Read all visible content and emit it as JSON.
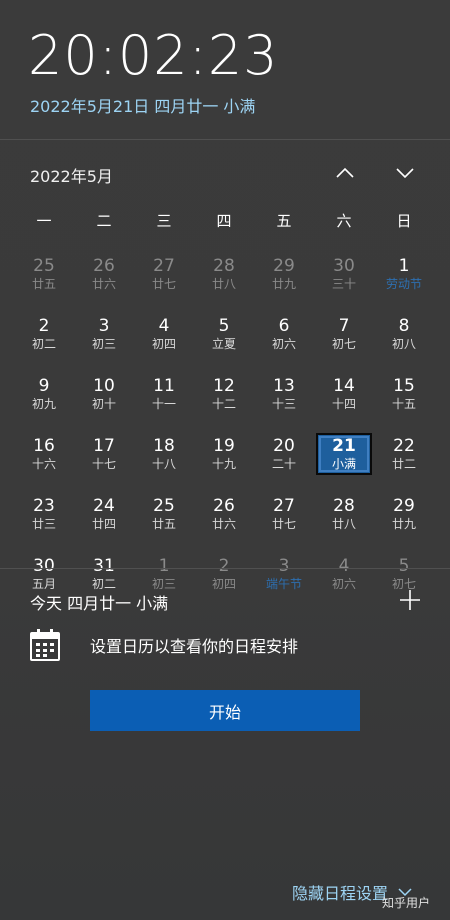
{
  "clock": {
    "time": "20:02:23",
    "date": "2022年5月21日 四月廿一 小满"
  },
  "calendar": {
    "month_title": "2022年5月",
    "weekdays": [
      "一",
      "二",
      "三",
      "四",
      "五",
      "六",
      "日"
    ],
    "days": [
      {
        "num": "25",
        "lunar": "廿五",
        "state": "other"
      },
      {
        "num": "26",
        "lunar": "廿六",
        "state": "other"
      },
      {
        "num": "27",
        "lunar": "廿七",
        "state": "other"
      },
      {
        "num": "28",
        "lunar": "廿八",
        "state": "other"
      },
      {
        "num": "29",
        "lunar": "廿九",
        "state": "other"
      },
      {
        "num": "30",
        "lunar": "三十",
        "state": "other"
      },
      {
        "num": "1",
        "lunar": "劳动节",
        "state": "cur festival"
      },
      {
        "num": "2",
        "lunar": "初二",
        "state": "cur"
      },
      {
        "num": "3",
        "lunar": "初三",
        "state": "cur"
      },
      {
        "num": "4",
        "lunar": "初四",
        "state": "cur"
      },
      {
        "num": "5",
        "lunar": "立夏",
        "state": "cur"
      },
      {
        "num": "6",
        "lunar": "初六",
        "state": "cur"
      },
      {
        "num": "7",
        "lunar": "初七",
        "state": "cur"
      },
      {
        "num": "8",
        "lunar": "初八",
        "state": "cur"
      },
      {
        "num": "9",
        "lunar": "初九",
        "state": "cur"
      },
      {
        "num": "10",
        "lunar": "初十",
        "state": "cur"
      },
      {
        "num": "11",
        "lunar": "十一",
        "state": "cur"
      },
      {
        "num": "12",
        "lunar": "十二",
        "state": "cur"
      },
      {
        "num": "13",
        "lunar": "十三",
        "state": "cur"
      },
      {
        "num": "14",
        "lunar": "十四",
        "state": "cur"
      },
      {
        "num": "15",
        "lunar": "十五",
        "state": "cur"
      },
      {
        "num": "16",
        "lunar": "十六",
        "state": "cur"
      },
      {
        "num": "17",
        "lunar": "十七",
        "state": "cur"
      },
      {
        "num": "18",
        "lunar": "十八",
        "state": "cur"
      },
      {
        "num": "19",
        "lunar": "十九",
        "state": "cur"
      },
      {
        "num": "20",
        "lunar": "二十",
        "state": "cur"
      },
      {
        "num": "21",
        "lunar": "小满",
        "state": "cur today"
      },
      {
        "num": "22",
        "lunar": "廿二",
        "state": "cur"
      },
      {
        "num": "23",
        "lunar": "廿三",
        "state": "cur"
      },
      {
        "num": "24",
        "lunar": "廿四",
        "state": "cur"
      },
      {
        "num": "25",
        "lunar": "廿五",
        "state": "cur"
      },
      {
        "num": "26",
        "lunar": "廿六",
        "state": "cur"
      },
      {
        "num": "27",
        "lunar": "廿七",
        "state": "cur"
      },
      {
        "num": "28",
        "lunar": "廿八",
        "state": "cur"
      },
      {
        "num": "29",
        "lunar": "廿九",
        "state": "cur"
      },
      {
        "num": "30",
        "lunar": "五月",
        "state": "cur"
      },
      {
        "num": "31",
        "lunar": "初二",
        "state": "cur"
      },
      {
        "num": "1",
        "lunar": "初三",
        "state": "other"
      },
      {
        "num": "2",
        "lunar": "初四",
        "state": "other"
      },
      {
        "num": "3",
        "lunar": "端午节",
        "state": "other festival"
      },
      {
        "num": "4",
        "lunar": "初六",
        "state": "other"
      },
      {
        "num": "5",
        "lunar": "初七",
        "state": "other"
      }
    ]
  },
  "agenda": {
    "title": "今天 四月廿一 小满",
    "message": "设置日历以查看你的日程安排",
    "start_label": "开始",
    "hide_label": "隐藏日程设置"
  },
  "watermark": "知乎用户",
  "colors": {
    "accent": "#0b5eb4",
    "link": "#9dd4f4",
    "today": "#1e5f9d",
    "festival": "#2d6fb0"
  }
}
